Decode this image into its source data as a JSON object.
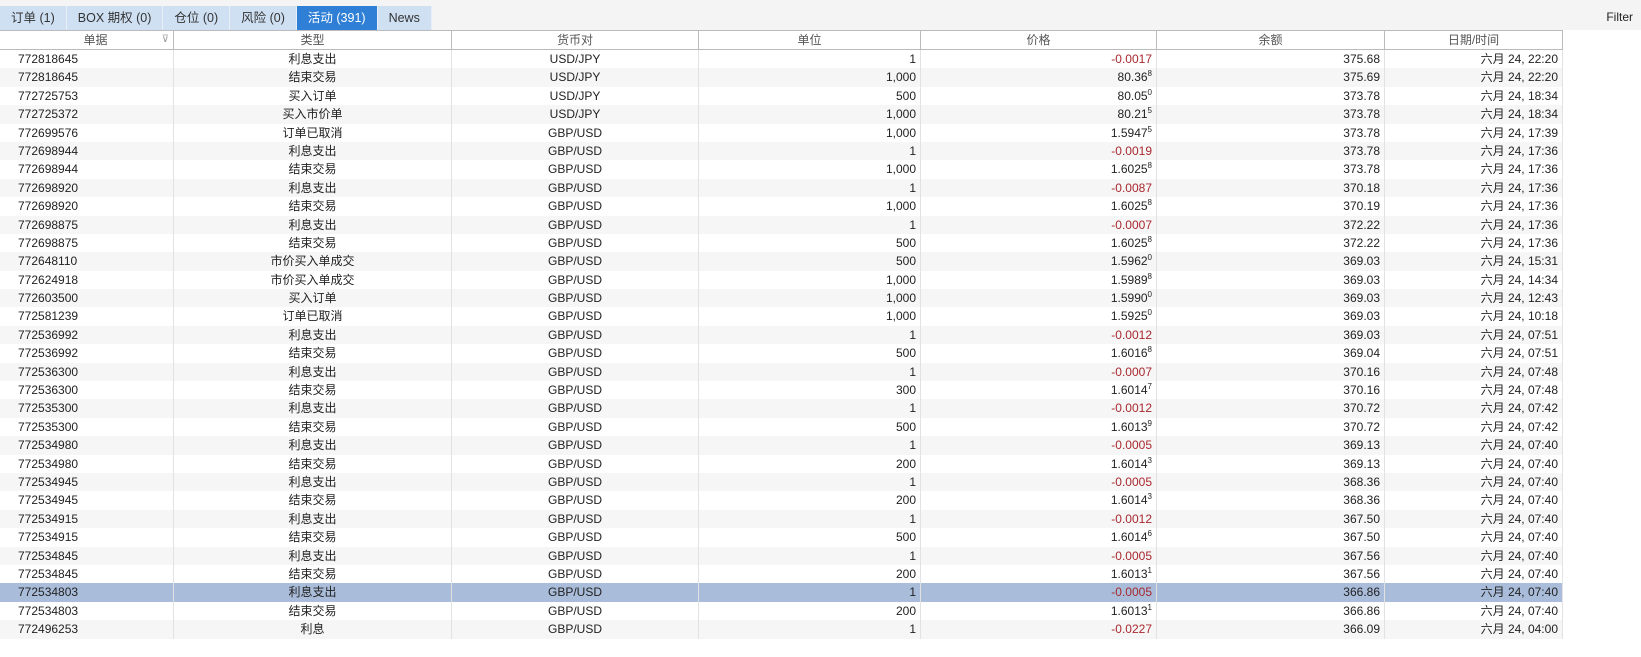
{
  "tabs": [
    "订单 (1)",
    "BOX 期权 (0)",
    "仓位 (0)",
    "风险 (0)",
    "活动 (391)",
    "News"
  ],
  "active_tab": 4,
  "filter_label": "Filter",
  "columns": [
    "单据",
    "类型",
    "货币对",
    "单位",
    "价格",
    "余额",
    "日期/时间"
  ],
  "selected_row": 29,
  "rows": [
    [
      "772818645",
      "利息支出",
      "USD/JPY",
      "1",
      "-0.0017",
      "",
      "375.68",
      "六月 24, 22:20"
    ],
    [
      "772818645",
      "结束交易",
      "USD/JPY",
      "1,000",
      "80.36",
      "8",
      "375.69",
      "六月 24, 22:20"
    ],
    [
      "772725753",
      "买入订单",
      "USD/JPY",
      "500",
      "80.05",
      "0",
      "373.78",
      "六月 24, 18:34"
    ],
    [
      "772725372",
      "买入市价单",
      "USD/JPY",
      "1,000",
      "80.21",
      "5",
      "373.78",
      "六月 24, 18:34"
    ],
    [
      "772699576",
      "订单已取消",
      "GBP/USD",
      "1,000",
      "1.5947",
      "5",
      "373.78",
      "六月 24, 17:39"
    ],
    [
      "772698944",
      "利息支出",
      "GBP/USD",
      "1",
      "-0.0019",
      "",
      "373.78",
      "六月 24, 17:36"
    ],
    [
      "772698944",
      "结束交易",
      "GBP/USD",
      "1,000",
      "1.6025",
      "8",
      "373.78",
      "六月 24, 17:36"
    ],
    [
      "772698920",
      "利息支出",
      "GBP/USD",
      "1",
      "-0.0087",
      "",
      "370.18",
      "六月 24, 17:36"
    ],
    [
      "772698920",
      "结束交易",
      "GBP/USD",
      "1,000",
      "1.6025",
      "8",
      "370.19",
      "六月 24, 17:36"
    ],
    [
      "772698875",
      "利息支出",
      "GBP/USD",
      "1",
      "-0.0007",
      "",
      "372.22",
      "六月 24, 17:36"
    ],
    [
      "772698875",
      "结束交易",
      "GBP/USD",
      "500",
      "1.6025",
      "8",
      "372.22",
      "六月 24, 17:36"
    ],
    [
      "772648110",
      "市价买入单成交",
      "GBP/USD",
      "500",
      "1.5962",
      "0",
      "369.03",
      "六月 24, 15:31"
    ],
    [
      "772624918",
      "市价买入单成交",
      "GBP/USD",
      "1,000",
      "1.5989",
      "8",
      "369.03",
      "六月 24, 14:34"
    ],
    [
      "772603500",
      "买入订单",
      "GBP/USD",
      "1,000",
      "1.5990",
      "0",
      "369.03",
      "六月 24, 12:43"
    ],
    [
      "772581239",
      "订单已取消",
      "GBP/USD",
      "1,000",
      "1.5925",
      "0",
      "369.03",
      "六月 24, 10:18"
    ],
    [
      "772536992",
      "利息支出",
      "GBP/USD",
      "1",
      "-0.0012",
      "",
      "369.03",
      "六月 24, 07:51"
    ],
    [
      "772536992",
      "结束交易",
      "GBP/USD",
      "500",
      "1.6016",
      "8",
      "369.04",
      "六月 24, 07:51"
    ],
    [
      "772536300",
      "利息支出",
      "GBP/USD",
      "1",
      "-0.0007",
      "",
      "370.16",
      "六月 24, 07:48"
    ],
    [
      "772536300",
      "结束交易",
      "GBP/USD",
      "300",
      "1.6014",
      "7",
      "370.16",
      "六月 24, 07:48"
    ],
    [
      "772535300",
      "利息支出",
      "GBP/USD",
      "1",
      "-0.0012",
      "",
      "370.72",
      "六月 24, 07:42"
    ],
    [
      "772535300",
      "结束交易",
      "GBP/USD",
      "500",
      "1.6013",
      "9",
      "370.72",
      "六月 24, 07:42"
    ],
    [
      "772534980",
      "利息支出",
      "GBP/USD",
      "1",
      "-0.0005",
      "",
      "369.13",
      "六月 24, 07:40"
    ],
    [
      "772534980",
      "结束交易",
      "GBP/USD",
      "200",
      "1.6014",
      "3",
      "369.13",
      "六月 24, 07:40"
    ],
    [
      "772534945",
      "利息支出",
      "GBP/USD",
      "1",
      "-0.0005",
      "",
      "368.36",
      "六月 24, 07:40"
    ],
    [
      "772534945",
      "结束交易",
      "GBP/USD",
      "200",
      "1.6014",
      "3",
      "368.36",
      "六月 24, 07:40"
    ],
    [
      "772534915",
      "利息支出",
      "GBP/USD",
      "1",
      "-0.0012",
      "",
      "367.50",
      "六月 24, 07:40"
    ],
    [
      "772534915",
      "结束交易",
      "GBP/USD",
      "500",
      "1.6014",
      "6",
      "367.50",
      "六月 24, 07:40"
    ],
    [
      "772534845",
      "利息支出",
      "GBP/USD",
      "1",
      "-0.0005",
      "",
      "367.56",
      "六月 24, 07:40"
    ],
    [
      "772534845",
      "结束交易",
      "GBP/USD",
      "200",
      "1.6013",
      "1",
      "367.56",
      "六月 24, 07:40"
    ],
    [
      "772534803",
      "利息支出",
      "GBP/USD",
      "1",
      "-0.0005",
      "",
      "366.86",
      "六月 24, 07:40"
    ],
    [
      "772534803",
      "结束交易",
      "GBP/USD",
      "200",
      "1.6013",
      "1",
      "366.86",
      "六月 24, 07:40"
    ],
    [
      "772496253",
      "利息",
      "GBP/USD",
      "1",
      "-0.0227",
      "",
      "366.09",
      "六月 24, 04:00"
    ]
  ],
  "colors": {
    "accent": "#2f7fd6",
    "tab_bg": "#cfe0f3",
    "negative": "#a8282e",
    "selected": "#a9bcd9"
  }
}
